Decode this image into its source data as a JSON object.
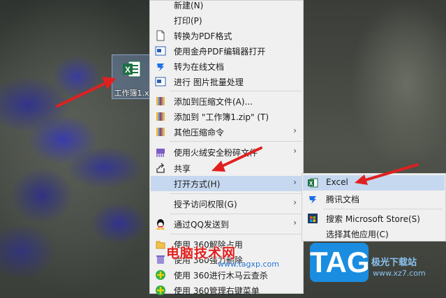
{
  "desktop": {
    "file_name": "工作簿1.x"
  },
  "context_menu": {
    "items": [
      {
        "label": "新建(N)",
        "icon": "",
        "arrow": false
      },
      {
        "label": "打印(P)",
        "icon": "",
        "arrow": false
      },
      {
        "label": "转换为PDF格式",
        "icon": "document-icon",
        "arrow": false
      },
      {
        "label": "使用金舟PDF编辑器打开",
        "icon": "pdf-editor-icon",
        "arrow": false
      },
      {
        "label": "转为在线文档",
        "icon": "tencent-docs-icon",
        "arrow": false
      },
      {
        "label": "进行 图片批量处理",
        "icon": "image-batch-icon",
        "arrow": false
      },
      {
        "label": "添加到压缩文件(A)...",
        "icon": "archive-icon",
        "arrow": false
      },
      {
        "label": "添加到 \"工作簿1.zip\" (T)",
        "icon": "archive-icon",
        "arrow": false
      },
      {
        "label": "其他压缩命令",
        "icon": "archive-icon",
        "arrow": true
      },
      {
        "label": "使用火绒安全粉碎文件",
        "icon": "shredder-icon",
        "arrow": true
      },
      {
        "label": "共享",
        "icon": "share-icon",
        "arrow": false
      },
      {
        "label": "打开方式(H)",
        "icon": "",
        "arrow": true
      },
      {
        "label": "授予访问权限(G)",
        "icon": "",
        "arrow": true
      },
      {
        "label": "通过QQ发送到",
        "icon": "qq-icon",
        "arrow": true
      },
      {
        "label": "使用 360解除占用",
        "icon": "360-unlock-icon",
        "arrow": false
      },
      {
        "label": "使用 360强力删除",
        "icon": "360-delete-icon",
        "arrow": false
      },
      {
        "label": "使用 360进行木马云查杀",
        "icon": "360-scan-icon",
        "arrow": false
      },
      {
        "label": "使用 360管理右键菜单",
        "icon": "360-manage-icon",
        "arrow": false
      }
    ]
  },
  "submenu": {
    "items": [
      {
        "label": "Excel",
        "icon": "excel-icon"
      },
      {
        "label": "腾讯文档",
        "icon": "tencent-docs-icon"
      },
      {
        "label": "搜索 Microsoft Store(S)",
        "icon": "store-icon"
      },
      {
        "label": "选择其他应用(C)",
        "icon": ""
      }
    ]
  },
  "watermark": {
    "title": "电脑技术网",
    "url": "www.tagxp.com",
    "logo": "TAG",
    "side_text": "极光下载站",
    "side_url": "www.xz7.com"
  },
  "colors": {
    "highlight": "#c6d8ef",
    "menu_bg": "#f0f0f0",
    "arrow_red": "#e02020",
    "excel_green": "#1d7044"
  }
}
